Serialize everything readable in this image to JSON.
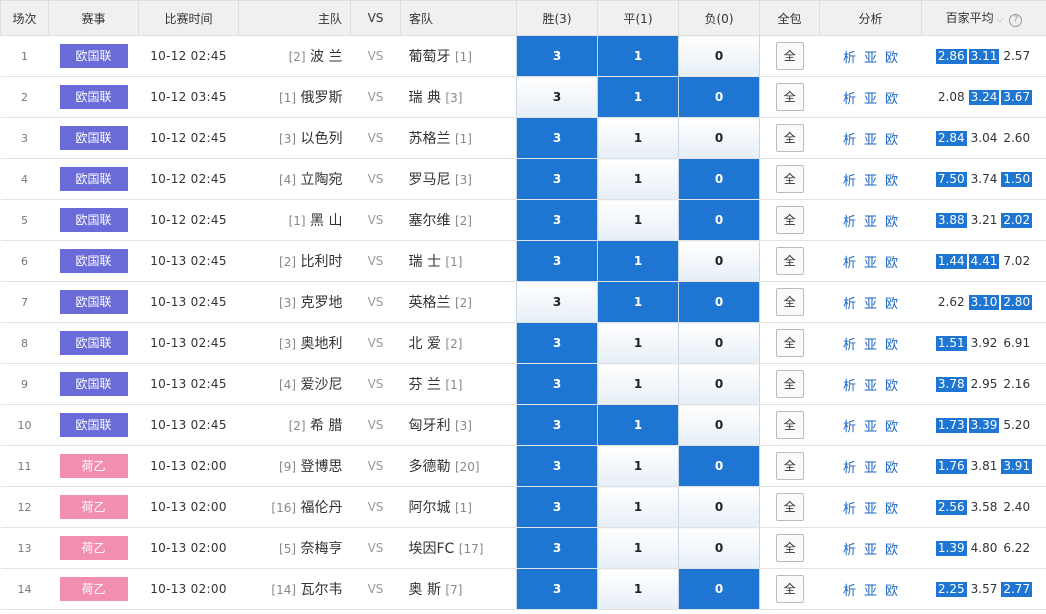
{
  "headers": {
    "round": "场次",
    "league": "赛事",
    "time": "比赛时间",
    "home": "主队",
    "vs": "VS",
    "away": "客队",
    "win": "胜(3)",
    "draw": "平(1)",
    "lose": "负(0)",
    "all": "全包",
    "analysis": "分析",
    "avg": "百家平均"
  },
  "colors": {
    "league_euro": "#6a6ad8",
    "league_nl2": "#f28fb0",
    "selected": "#1e76d2"
  },
  "rows": [
    {
      "no": "1",
      "league": "欧国联",
      "league_type": "euro",
      "time": "10-12 02:45",
      "home_rank": "[2]",
      "home": "波 兰",
      "vs": "VS",
      "away": "葡萄牙",
      "away_rank": "[1]",
      "win": "3",
      "draw": "1",
      "lose": "0",
      "sel": [
        1,
        1,
        0
      ],
      "all": "全",
      "a1": "析",
      "a2": "亚",
      "a3": "欧",
      "o1": "2.86",
      "o2": "3.11",
      "o3": "2.57",
      "hl": [
        1,
        1,
        0
      ]
    },
    {
      "no": "2",
      "league": "欧国联",
      "league_type": "euro",
      "time": "10-12 03:45",
      "home_rank": "[1]",
      "home": "俄罗斯",
      "vs": "VS",
      "away": "瑞 典",
      "away_rank": "[3]",
      "win": "3",
      "draw": "1",
      "lose": "0",
      "sel": [
        0,
        1,
        1
      ],
      "all": "全",
      "a1": "析",
      "a2": "亚",
      "a3": "欧",
      "o1": "2.08",
      "o2": "3.24",
      "o3": "3.67",
      "hl": [
        0,
        1,
        1
      ]
    },
    {
      "no": "3",
      "league": "欧国联",
      "league_type": "euro",
      "time": "10-12 02:45",
      "home_rank": "[3]",
      "home": "以色列",
      "vs": "VS",
      "away": "苏格兰",
      "away_rank": "[1]",
      "win": "3",
      "draw": "1",
      "lose": "0",
      "sel": [
        1,
        0,
        0
      ],
      "all": "全",
      "a1": "析",
      "a2": "亚",
      "a3": "欧",
      "o1": "2.84",
      "o2": "3.04",
      "o3": "2.60",
      "hl": [
        1,
        0,
        0
      ]
    },
    {
      "no": "4",
      "league": "欧国联",
      "league_type": "euro",
      "time": "10-12 02:45",
      "home_rank": "[4]",
      "home": "立陶宛",
      "vs": "VS",
      "away": "罗马尼",
      "away_rank": "[3]",
      "win": "3",
      "draw": "1",
      "lose": "0",
      "sel": [
        1,
        0,
        1
      ],
      "all": "全",
      "a1": "析",
      "a2": "亚",
      "a3": "欧",
      "o1": "7.50",
      "o2": "3.74",
      "o3": "1.50",
      "hl": [
        1,
        0,
        1
      ]
    },
    {
      "no": "5",
      "league": "欧国联",
      "league_type": "euro",
      "time": "10-12 02:45",
      "home_rank": "[1]",
      "home": "黑 山",
      "vs": "VS",
      "away": "塞尔维",
      "away_rank": "[2]",
      "win": "3",
      "draw": "1",
      "lose": "0",
      "sel": [
        1,
        0,
        1
      ],
      "all": "全",
      "a1": "析",
      "a2": "亚",
      "a3": "欧",
      "o1": "3.88",
      "o2": "3.21",
      "o3": "2.02",
      "hl": [
        1,
        0,
        1
      ]
    },
    {
      "no": "6",
      "league": "欧国联",
      "league_type": "euro",
      "time": "10-13 02:45",
      "home_rank": "[2]",
      "home": "比利时",
      "vs": "VS",
      "away": "瑞 士",
      "away_rank": "[1]",
      "win": "3",
      "draw": "1",
      "lose": "0",
      "sel": [
        1,
        1,
        0
      ],
      "all": "全",
      "a1": "析",
      "a2": "亚",
      "a3": "欧",
      "o1": "1.44",
      "o2": "4.41",
      "o3": "7.02",
      "hl": [
        1,
        1,
        0
      ]
    },
    {
      "no": "7",
      "league": "欧国联",
      "league_type": "euro",
      "time": "10-13 02:45",
      "home_rank": "[3]",
      "home": "克罗地",
      "vs": "VS",
      "away": "英格兰",
      "away_rank": "[2]",
      "win": "3",
      "draw": "1",
      "lose": "0",
      "sel": [
        0,
        1,
        1
      ],
      "all": "全",
      "a1": "析",
      "a2": "亚",
      "a3": "欧",
      "o1": "2.62",
      "o2": "3.10",
      "o3": "2.80",
      "hl": [
        0,
        1,
        1
      ]
    },
    {
      "no": "8",
      "league": "欧国联",
      "league_type": "euro",
      "time": "10-13 02:45",
      "home_rank": "[3]",
      "home": "奥地利",
      "vs": "VS",
      "away": "北 爱",
      "away_rank": "[2]",
      "win": "3",
      "draw": "1",
      "lose": "0",
      "sel": [
        1,
        0,
        0
      ],
      "all": "全",
      "a1": "析",
      "a2": "亚",
      "a3": "欧",
      "o1": "1.51",
      "o2": "3.92",
      "o3": "6.91",
      "hl": [
        1,
        0,
        0
      ]
    },
    {
      "no": "9",
      "league": "欧国联",
      "league_type": "euro",
      "time": "10-13 02:45",
      "home_rank": "[4]",
      "home": "爱沙尼",
      "vs": "VS",
      "away": "芬 兰",
      "away_rank": "[1]",
      "win": "3",
      "draw": "1",
      "lose": "0",
      "sel": [
        1,
        0,
        0
      ],
      "all": "全",
      "a1": "析",
      "a2": "亚",
      "a3": "欧",
      "o1": "3.78",
      "o2": "2.95",
      "o3": "2.16",
      "hl": [
        1,
        0,
        0
      ]
    },
    {
      "no": "10",
      "league": "欧国联",
      "league_type": "euro",
      "time": "10-13 02:45",
      "home_rank": "[2]",
      "home": "希 腊",
      "vs": "VS",
      "away": "匈牙利",
      "away_rank": "[3]",
      "win": "3",
      "draw": "1",
      "lose": "0",
      "sel": [
        1,
        1,
        0
      ],
      "all": "全",
      "a1": "析",
      "a2": "亚",
      "a3": "欧",
      "o1": "1.73",
      "o2": "3.39",
      "o3": "5.20",
      "hl": [
        1,
        1,
        0
      ]
    },
    {
      "no": "11",
      "league": "荷乙",
      "league_type": "nl2",
      "time": "10-13 02:00",
      "home_rank": "[9]",
      "home": "登博思",
      "vs": "VS",
      "away": "多德勒",
      "away_rank": "[20]",
      "win": "3",
      "draw": "1",
      "lose": "0",
      "sel": [
        1,
        0,
        1
      ],
      "all": "全",
      "a1": "析",
      "a2": "亚",
      "a3": "欧",
      "o1": "1.76",
      "o2": "3.81",
      "o3": "3.91",
      "hl": [
        1,
        0,
        1
      ]
    },
    {
      "no": "12",
      "league": "荷乙",
      "league_type": "nl2",
      "time": "10-13 02:00",
      "home_rank": "[16]",
      "home": "福伦丹",
      "vs": "VS",
      "away": "阿尔城",
      "away_rank": "[1]",
      "win": "3",
      "draw": "1",
      "lose": "0",
      "sel": [
        1,
        0,
        0
      ],
      "all": "全",
      "a1": "析",
      "a2": "亚",
      "a3": "欧",
      "o1": "2.56",
      "o2": "3.58",
      "o3": "2.40",
      "hl": [
        1,
        0,
        0
      ]
    },
    {
      "no": "13",
      "league": "荷乙",
      "league_type": "nl2",
      "time": "10-13 02:00",
      "home_rank": "[5]",
      "home": "奈梅亨",
      "vs": "VS",
      "away": "埃因FC",
      "away_rank": "[17]",
      "win": "3",
      "draw": "1",
      "lose": "0",
      "sel": [
        1,
        0,
        0
      ],
      "all": "全",
      "a1": "析",
      "a2": "亚",
      "a3": "欧",
      "o1": "1.39",
      "o2": "4.80",
      "o3": "6.22",
      "hl": [
        1,
        0,
        0
      ]
    },
    {
      "no": "14",
      "league": "荷乙",
      "league_type": "nl2",
      "time": "10-13 02:00",
      "home_rank": "[14]",
      "home": "瓦尔韦",
      "vs": "VS",
      "away": "奥 斯",
      "away_rank": "[7]",
      "win": "3",
      "draw": "1",
      "lose": "0",
      "sel": [
        1,
        0,
        1
      ],
      "all": "全",
      "a1": "析",
      "a2": "亚",
      "a3": "欧",
      "o1": "2.25",
      "o2": "3.57",
      "o3": "2.77",
      "hl": [
        1,
        0,
        1
      ]
    }
  ]
}
